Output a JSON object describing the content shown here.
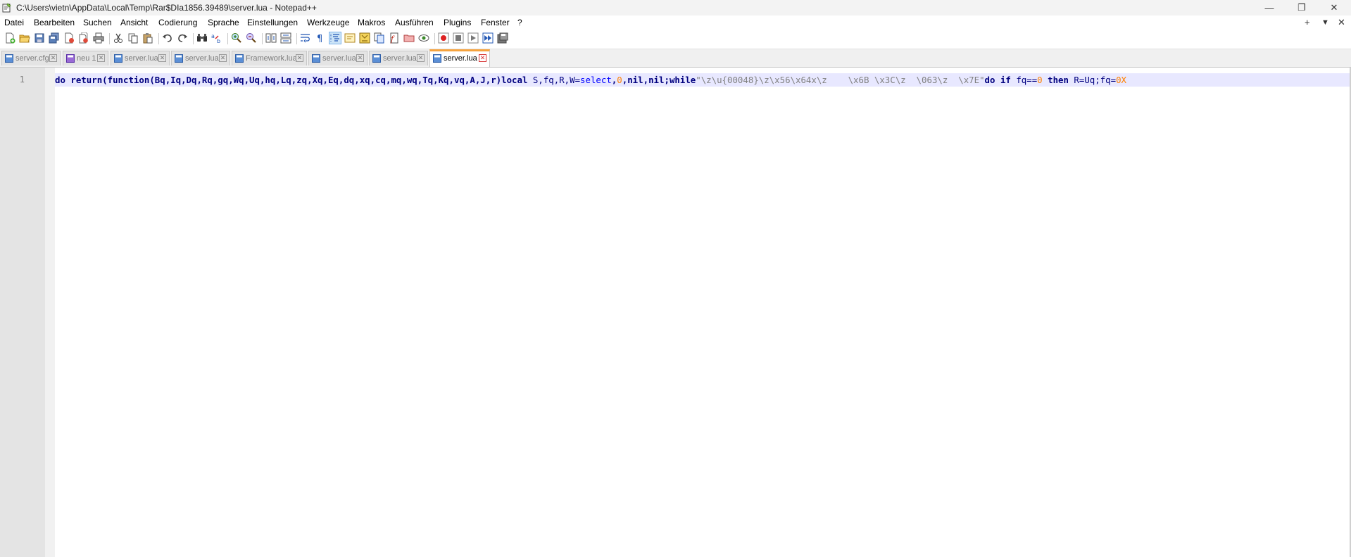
{
  "window": {
    "title": "C:\\Users\\vietn\\AppData\\Local\\Temp\\Rar$DIa1856.39489\\server.lua - Notepad++",
    "min_glyph": "—",
    "max_glyph": "❐",
    "close_glyph": "✕"
  },
  "menu": {
    "items": [
      "Datei",
      "Bearbeiten",
      "Suchen",
      "Ansicht",
      "Codierung",
      "Sprache",
      "Einstellungen",
      "Werkzeuge",
      "Makros",
      "Ausführen",
      "Plugins",
      "Fenster",
      "?"
    ],
    "right": [
      "+",
      "▼",
      "✕"
    ]
  },
  "tabs": [
    {
      "label": "server.cfg",
      "active": false
    },
    {
      "label": "neu 1",
      "active": false
    },
    {
      "label": "server.lua",
      "active": false
    },
    {
      "label": "server.lua",
      "active": false
    },
    {
      "label": "Framework.lua",
      "active": false
    },
    {
      "label": "server.lua",
      "active": false
    },
    {
      "label": "server.lua",
      "active": false
    },
    {
      "label": "server.lua",
      "active": true
    }
  ],
  "editor": {
    "line_number": "1",
    "code": {
      "t1": "do",
      "t2": " ",
      "t3": "return",
      "t4": "(",
      "t5": "function",
      "t6": "(Bq,Iq,Dq,Rq,gq,Wq,Uq,hq,Lq,zq,Xq,Eq,dq,xq,cq,mq,wq,Tq,Kq,vq,A,J,r)",
      "t7": "local",
      "t8": " S,fq,R,W=",
      "t9": "select",
      "t10": ",",
      "t11": "0",
      "t12": ",",
      "t13": "nil",
      "t14": ",",
      "t15": "nil",
      "t16": ";",
      "t17": "while",
      "t18": "\"\\z\\u{00048}\\z\\x56\\x64x\\z    \\x6B \\x3C\\z  \\063\\z  \\x7E\"",
      "t19": "do",
      "t20": " ",
      "t21": "if",
      "t22": " fq==",
      "t23": "0",
      "t24": " ",
      "t25": "then",
      "t26": " R=Uq;fq=",
      "t27": "0X"
    }
  },
  "colors": {
    "active_tab_accent": "#f6a33e",
    "current_line_bg": "#e8e8ff",
    "keyword": "#00007f",
    "number": "#ff8000",
    "string": "#808080"
  }
}
